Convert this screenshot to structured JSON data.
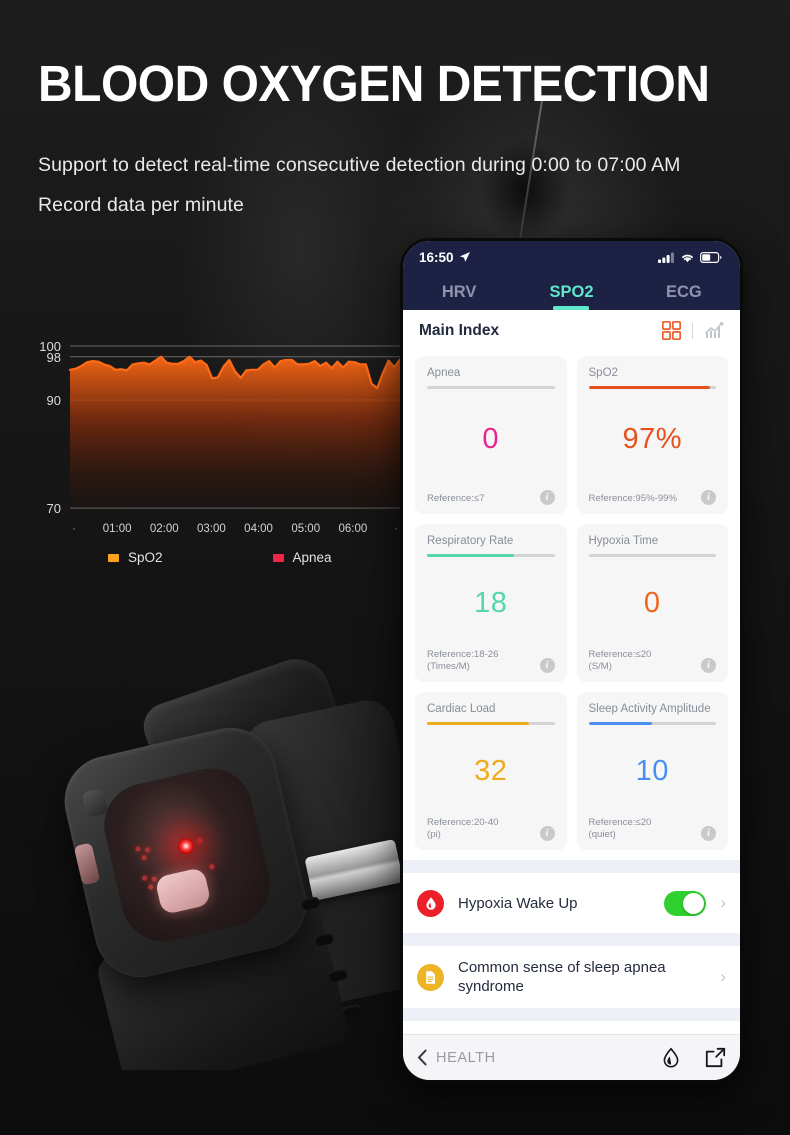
{
  "header": {
    "title": "BLOOD OXYGEN DETECTION",
    "subtitle_line1": "Support to detect real-time consecutive detection during 0:00 to 07:00 AM",
    "subtitle_line2": "Record data per minute"
  },
  "colors": {
    "accent_orange": "#ff6a15",
    "tab_active": "#5fe8cc",
    "toggle_on": "#2fd02f",
    "apnea_value": "#e8258f",
    "spo2_value": "#e8501e",
    "resp_value": "#54d6ae",
    "hypoxia_value": "#f0661e",
    "cardiac_value": "#efab1e",
    "sleep_value": "#4a8ff0",
    "page_bg": "#141414"
  },
  "chart_data": {
    "type": "area",
    "title": "",
    "xlabel": "",
    "ylabel": "",
    "ylim": [
      70,
      100
    ],
    "yticks": [
      100,
      98,
      90,
      70
    ],
    "xticks": [
      "01:00",
      "02:00",
      "03:00",
      "04:00",
      "05:00",
      "06:00"
    ],
    "grid": true,
    "legend_position": "bottom",
    "series": [
      {
        "name": "SpO2",
        "color": "#ff6a15",
        "values": [
          95.6,
          95.8,
          96.3,
          97.0,
          97.2,
          97.1,
          96.6,
          96.3,
          95.6,
          95.7,
          95.5,
          96.6,
          96.8,
          96.9,
          96.6,
          97.3,
          98.0,
          96.9,
          96.7,
          96.7,
          97.2,
          98.0,
          97.0,
          97.3,
          96.5,
          94.0,
          94.2,
          96.2,
          97.4,
          95.3,
          94.1,
          95.5,
          95.6,
          95.6,
          96.6,
          97.2,
          96.0,
          97.2,
          97.4,
          97.4,
          96.6,
          96.6,
          96.7,
          97.2,
          96.3,
          96.9,
          95.9,
          97.1,
          96.0,
          97.1,
          97.0,
          96.6,
          96.6,
          93.0,
          92.2,
          95.0,
          97.3,
          96.1,
          97.5
        ]
      },
      {
        "name": "Apnea",
        "color": "#f0264b",
        "values": []
      }
    ],
    "legend": [
      {
        "label": "SpO2",
        "color": "#ffa01e"
      },
      {
        "label": "Apnea",
        "color": "#f0264b"
      }
    ]
  },
  "phone": {
    "status": {
      "time": "16:50",
      "location_icon": "location-arrow-icon",
      "signal_icon": "cellular-signal-icon",
      "wifi_icon": "wifi-icon",
      "battery_icon": "battery-icon"
    },
    "tabs": [
      {
        "label": "HRV",
        "active": false
      },
      {
        "label": "SPO2",
        "active": true
      },
      {
        "label": "ECG",
        "active": false
      }
    ],
    "index": {
      "title": "Main Index",
      "grid_icon": "grid-view-icon",
      "chart_icon": "chart-view-icon"
    },
    "cards": [
      {
        "title": "Apnea",
        "value": "0",
        "value_color": "#e8258f",
        "reference": "Reference:≤7",
        "bar_color": "#b9bcc4",
        "bar_pct": 0,
        "info_icon": "info-icon"
      },
      {
        "title": "SpO2",
        "value": "97%",
        "value_color": "#e8501e",
        "reference": "Reference:95%-99%",
        "bar_color": "#e8501e",
        "bar_pct": 95,
        "info_icon": "info-icon"
      },
      {
        "title": "Respiratory Rate",
        "value": "18",
        "value_color": "#54d6ae",
        "reference": "Reference:18-26\n(Times/M)",
        "bar_color": "#54d6ae",
        "bar_pct": 68,
        "info_icon": "info-icon"
      },
      {
        "title": "Hypoxia Time",
        "value": "0",
        "value_color": "#f0661e",
        "reference": "Reference:≤20\n(S/M)",
        "bar_color": "#b9bcc4",
        "bar_pct": 0,
        "info_icon": "info-icon"
      },
      {
        "title": "Cardiac Load",
        "value": "32",
        "value_color": "#efab1e",
        "reference": "Reference:20-40\n(pi)",
        "bar_color": "#efab1e",
        "bar_pct": 80,
        "info_icon": "info-icon"
      },
      {
        "title": "Sleep Activity Amplitude",
        "value": "10",
        "value_color": "#4a8ff0",
        "reference": "Reference:≤20\n(quiet)",
        "bar_color": "#4a8ff0",
        "bar_pct": 50,
        "info_icon": "info-icon"
      }
    ],
    "rows": [
      {
        "label": "Hypoxia Wake Up",
        "icon": "blood-drop-icon",
        "icon_bg": "#ec2029",
        "toggle": true,
        "chevron": "›"
      },
      {
        "label": "Common sense of sleep apnea syndrome",
        "icon": "document-icon",
        "icon_bg": "#edb523",
        "toggle": false,
        "chevron": "›"
      }
    ],
    "bottombar": {
      "back_icon": "chevron-left-icon",
      "back_label": "HEALTH",
      "drop_icon": "water-drop-icon",
      "share_icon": "share-external-icon"
    }
  }
}
